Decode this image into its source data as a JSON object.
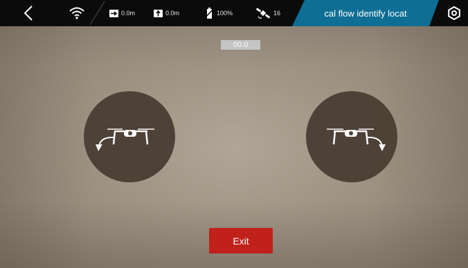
{
  "topbar": {
    "horizontal_distance": "0.0m",
    "vertical_distance": "0.0m",
    "battery": "100%",
    "satellites": "16",
    "mode_title": "cal flow identify locat"
  },
  "readout": {
    "value": "00.0"
  },
  "controls": {
    "exit_label": "Exit"
  },
  "icons": {
    "back": "chevron-left-icon",
    "wifi": "wifi-icon",
    "horizontal_distance": "arrow-right-icon",
    "vertical_distance": "arrow-up-icon",
    "battery": "battery-icon",
    "satellites": "satellite-icon",
    "settings": "gear-icon",
    "rotate_left": "drone-rotate-ccw-icon",
    "rotate_right": "drone-rotate-cw-icon"
  },
  "colors": {
    "topbar_bg": "#0b0b0b",
    "mode_tab": "#0e6e93",
    "exit_button": "#c0211a",
    "rotate_circle": "#4a3d33",
    "readout_bg": "#c4c4c4"
  }
}
